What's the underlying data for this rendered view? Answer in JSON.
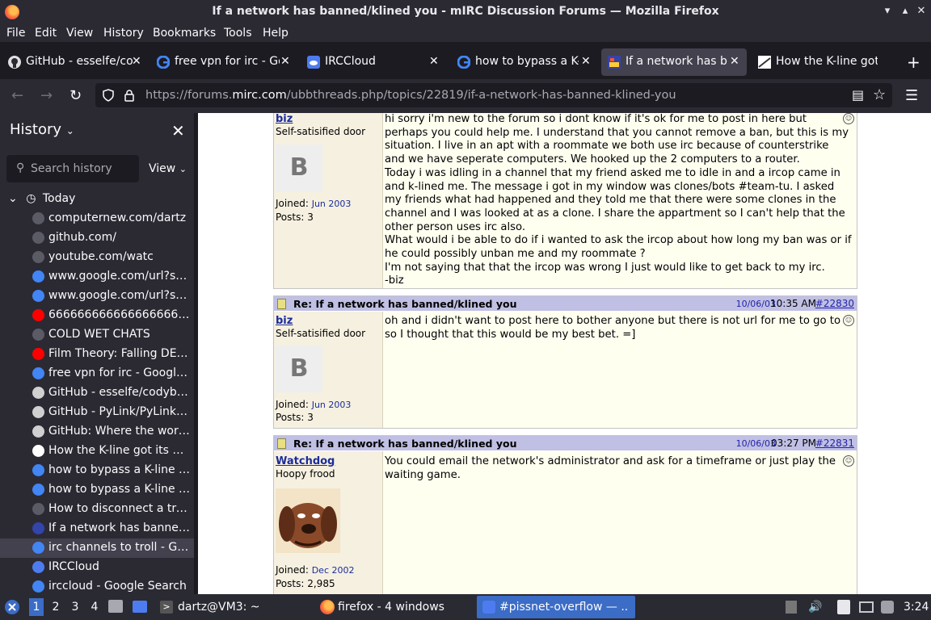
{
  "window": {
    "title": "If a network has banned/klined you - mIRC Discussion Forums — Mozilla Firefox"
  },
  "menu": [
    "File",
    "Edit",
    "View",
    "History",
    "Bookmarks",
    "Tools",
    "Help"
  ],
  "tabs": [
    {
      "label": "GitHub - esselfe/co",
      "icon": "github-icon"
    },
    {
      "label": "free vpn for irc - Go",
      "icon": "google-icon"
    },
    {
      "label": "IRCCloud",
      "icon": "irccloud-icon"
    },
    {
      "label": "how to bypass a K-li",
      "icon": "google-icon"
    },
    {
      "label": "If a network has ba",
      "icon": "mirc-icon"
    },
    {
      "label": "How the K-line got i",
      "icon": "page-icon"
    }
  ],
  "url": {
    "prefix": "https://forums.",
    "domain": "mirc.com",
    "path": "/ubbthreads.php/topics/22819/if-a-network-has-banned-klined-you"
  },
  "sidebar": {
    "title": "History",
    "search_placeholder": "Search history",
    "view_label": "View",
    "group": "Today",
    "items": [
      {
        "label": "computernew.com/dartz",
        "icon": "globe-icon",
        "color": "#5b5b66"
      },
      {
        "label": "github.com/",
        "icon": "globe-icon",
        "color": "#5b5b66"
      },
      {
        "label": "youtube.com/watc",
        "icon": "globe-icon",
        "color": "#5b5b66"
      },
      {
        "label": "www.google.com/url?sa...",
        "icon": "google-icon",
        "color": "#4285f4"
      },
      {
        "label": "www.google.com/url?sa...",
        "icon": "google-icon",
        "color": "#4285f4"
      },
      {
        "label": "6666666666666666666...",
        "icon": "youtube-icon",
        "color": "#ff0000"
      },
      {
        "label": "COLD WET CHATS",
        "icon": "globe-icon",
        "color": "#5b5b66"
      },
      {
        "label": "Film Theory: Falling DEE...",
        "icon": "youtube-icon",
        "color": "#ff0000"
      },
      {
        "label": "free vpn for irc - Google ...",
        "icon": "google-icon",
        "color": "#4285f4"
      },
      {
        "label": "GitHub - esselfe/codybot...",
        "icon": "github-icon",
        "color": "#d0d0d0"
      },
      {
        "label": "GitHub - PyLink/PyLink: ...",
        "icon": "github-icon",
        "color": "#d0d0d0"
      },
      {
        "label": "GitHub: Where the worl...",
        "icon": "github-icon",
        "color": "#d0d0d0"
      },
      {
        "label": "How the K-line got its na...",
        "icon": "page-icon",
        "color": "#ffffff"
      },
      {
        "label": "how to bypass a K-line ir...",
        "icon": "google-icon",
        "color": "#4285f4"
      },
      {
        "label": "how to bypass a K-line ir...",
        "icon": "google-icon",
        "color": "#4285f4"
      },
      {
        "label": "How to disconnect a trol...",
        "icon": "globe-icon",
        "color": "#5b5b66"
      },
      {
        "label": "If a network has banned...",
        "icon": "mirc-icon",
        "color": "#3344aa"
      },
      {
        "label": "irc channels to troll - Go...",
        "icon": "google-icon",
        "color": "#4285f4"
      },
      {
        "label": "IRCCloud",
        "icon": "irccloud-icon",
        "color": "#4d7cf0"
      },
      {
        "label": "irccloud - Google Search",
        "icon": "google-icon",
        "color": "#4285f4"
      }
    ]
  },
  "posts": [
    {
      "user": "biz",
      "user_title": "Self-satisified door",
      "avatar_letter": "B",
      "joined_label": "Joined:",
      "joined": "Jun 2003",
      "posts_label": "Posts:",
      "posts": "3",
      "body": [
        "hi sorry i'm new to the forum so i dont know if it's ok for me to post in here but perhaps you could help me. I understand that you cannot remove a ban, but this is my situation. I live in an apt with a roommate we both use irc because of counterstrike and we have seperate computers. We hooked up the 2 computers to a router.",
        "Today i was idling in a channel that my friend asked me to idle in and a ircop came in and k-lined me. The message i got in my window was clones/bots #team-tu. I asked my friends what had happened and they told me that there were some clones in the channel and I was looked at as a clone. I share the appartment so I can't help that the other person uses irc also.",
        "What would i be able to do if i wanted to ask the ircop about how long my ban was or if he could possibly unban me and my roommate ?",
        "I'm not saying that that the ircop was wrong I just would like to get back to my irc.",
        "-biz"
      ]
    },
    {
      "title": "Re: If a network has banned/klined you",
      "date": "10/06/03",
      "time": "10:35 AM",
      "link": "#22830",
      "user": "biz",
      "user_title": "Self-satisified door",
      "avatar_letter": "B",
      "joined_label": "Joined:",
      "joined": "Jun 2003",
      "posts_label": "Posts:",
      "posts": "3",
      "body": [
        "oh and i didn't want to post here to bother anyone but there is not url for me to go to so I thought that this would be my best bet. =]"
      ]
    },
    {
      "title": "Re: If a network has banned/klined you",
      "date": "10/06/03",
      "time": "03:27 PM",
      "link": "#22831",
      "user": "Watchdog",
      "user_title": "Hoopy frood",
      "joined_label": "Joined:",
      "joined": "Dec 2002",
      "posts_label": "Posts:",
      "posts": "2,985",
      "body": [
        "You could email the network's administrator and ask for a timeframe or just play the waiting game."
      ]
    }
  ],
  "taskbar": {
    "workspaces": [
      "1",
      "2",
      "3",
      "4"
    ],
    "terminal": "dartz@VM3: ~",
    "firefox": "firefox - 4 windows",
    "chat": "#pissnet-overflow — ...",
    "clock": "3:24"
  }
}
